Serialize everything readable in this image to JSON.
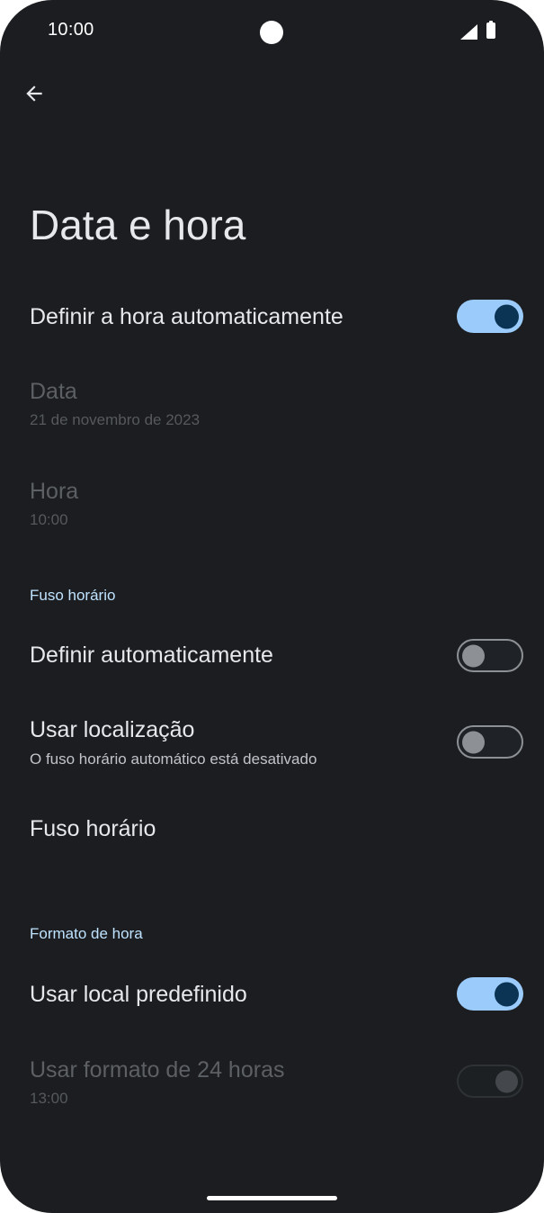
{
  "status_bar": {
    "time": "10:00",
    "icons": [
      "signal-icon",
      "battery-icon"
    ]
  },
  "app_bar": {
    "back_icon": "arrow-back-icon"
  },
  "page": {
    "title": "Data e hora"
  },
  "settings": {
    "auto_time": {
      "title": "Definir a hora automaticamente",
      "enabled": true,
      "checked": true
    },
    "date": {
      "title": "Data",
      "summary": "21 de novembro de 2023",
      "enabled": false
    },
    "time": {
      "title": "Hora",
      "summary": "10:00",
      "enabled": false
    },
    "timezone_section": {
      "header": "Fuso horário",
      "auto_timezone": {
        "title": "Definir automaticamente",
        "checked": false
      },
      "use_location": {
        "title": "Usar localização",
        "summary": "O fuso horário automático está desativado",
        "checked": false
      },
      "timezone": {
        "title": "Fuso horário"
      }
    },
    "time_format_section": {
      "header": "Formato de hora",
      "use_locale_default": {
        "title": "Usar local predefinido",
        "checked": true
      },
      "use_24_hour": {
        "title": "Usar formato de 24 horas",
        "summary": "13:00",
        "checked": true,
        "enabled": false
      }
    }
  },
  "colors": {
    "background": "#1b1d20",
    "accent": "#9bcbfb",
    "section_header": "#bfe3ff",
    "text_primary": "#e6e8ec",
    "text_disabled": "#5c6064"
  }
}
